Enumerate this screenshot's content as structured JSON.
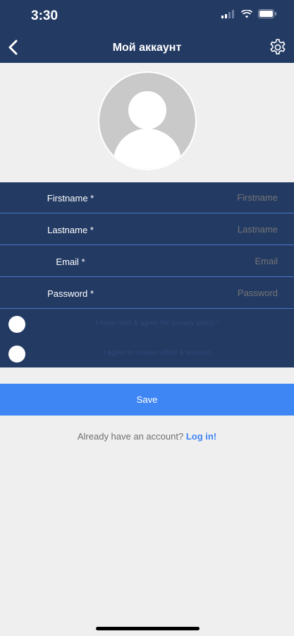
{
  "status_bar": {
    "time": "3:30"
  },
  "header": {
    "title": "Мой аккаунт"
  },
  "form": {
    "fields": [
      {
        "label": "Firstname *",
        "placeholder": "Firstname"
      },
      {
        "label": "Lastname *",
        "placeholder": "Lastname"
      },
      {
        "label": "Email *",
        "placeholder": "Email"
      },
      {
        "label": "Password *",
        "placeholder": "Password"
      }
    ],
    "checks": [
      {
        "label": "I have read & agree the privacy policy *"
      },
      {
        "label": "I agree to receive offers & services"
      }
    ]
  },
  "actions": {
    "save_label": "Save"
  },
  "footer": {
    "prompt": "Already have an account?",
    "login_link": "Log in!"
  },
  "colors": {
    "header_bg": "#233a63",
    "form_bg": "#233a63",
    "row_divider": "#4c79c9",
    "accent": "#3f86f5",
    "page_bg": "#efefef"
  }
}
